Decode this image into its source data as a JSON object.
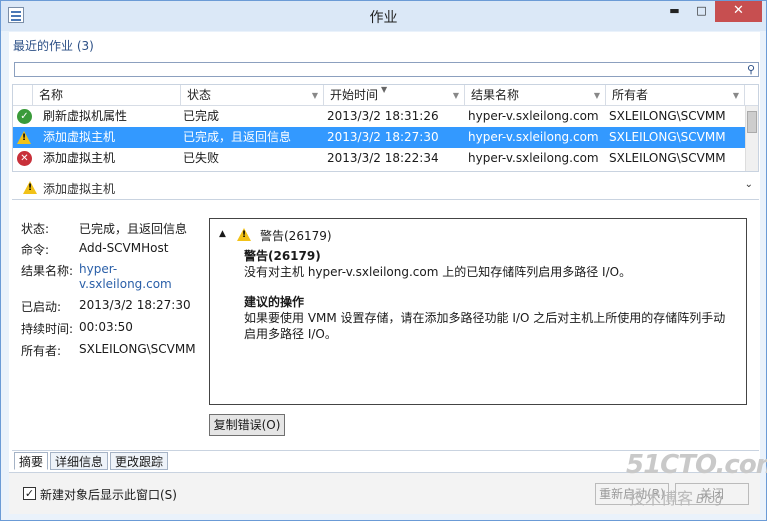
{
  "window": {
    "title": "作业"
  },
  "window_buttons": {
    "minimize": "▬",
    "maximize": "□",
    "close": "✕"
  },
  "recent_jobs_label": "最近的作业 (3)",
  "grid": {
    "columns": [
      "名称",
      "状态",
      "开始时间",
      "结果名称",
      "所有者"
    ],
    "rows": [
      {
        "icon": "success-icon",
        "name": "刷新虚拟机属性",
        "status": "已完成",
        "start": "2013/3/2 18:31:26",
        "result": "hyper-v.sxleilong.com",
        "owner": "SXLEILONG\\SCVMM",
        "selected": false
      },
      {
        "icon": "warning-icon",
        "name": "添加虚拟主机",
        "status": "已完成，且返回信息",
        "start": "2013/3/2 18:27:30",
        "result": "hyper-v.sxleilong.com",
        "owner": "SXLEILONG\\SCVMM",
        "selected": true
      },
      {
        "icon": "error-icon",
        "name": "添加虚拟主机",
        "status": "已失败",
        "start": "2013/3/2 18:22:34",
        "result": "hyper-v.sxleilong.com",
        "owner": "SXLEILONG\\SCVMM",
        "selected": false
      }
    ]
  },
  "detail": {
    "title": "添加虚拟主机",
    "props": {
      "status_label": "状态:",
      "status_value": "已完成，且返回信息",
      "command_label": "命令:",
      "command_value": "Add-SCVMHost",
      "result_label": "结果名称:",
      "result_value_1": "hyper-",
      "result_value_2": "v.sxleilong.com",
      "started_label": "已启动:",
      "started_value": "2013/3/2 18:27:30",
      "duration_label": "持续时间:",
      "duration_value": "00:03:50",
      "owner_label": "所有者:",
      "owner_value": "SXLEILONG\\SCVMM"
    },
    "message": {
      "header": "警告(26179)",
      "title": "警告(26179)",
      "line1": "没有对主机 hyper-v.sxleilong.com 上的已知存储阵列启用多路径 I/O。",
      "action_title": "建议的操作",
      "action_line1": "如果要使用 VMM 设置存储，请在添加多路径功能 I/O 之后对主机上所使用的存储阵列手动",
      "action_line2": "启用多路径 I/O。"
    },
    "copy_button": "复制错误(O)"
  },
  "tabs": [
    "摘要",
    "详细信息",
    "更改跟踪"
  ],
  "footer": {
    "checkbox_label": "新建对象后显示此窗口(S)",
    "checkbox_checked": true,
    "restart_button": "重新启动(R)",
    "close_button": "关闭"
  },
  "watermark": {
    "big": "51CTO.com",
    "sub": "技术博客",
    "url": "Blog"
  }
}
